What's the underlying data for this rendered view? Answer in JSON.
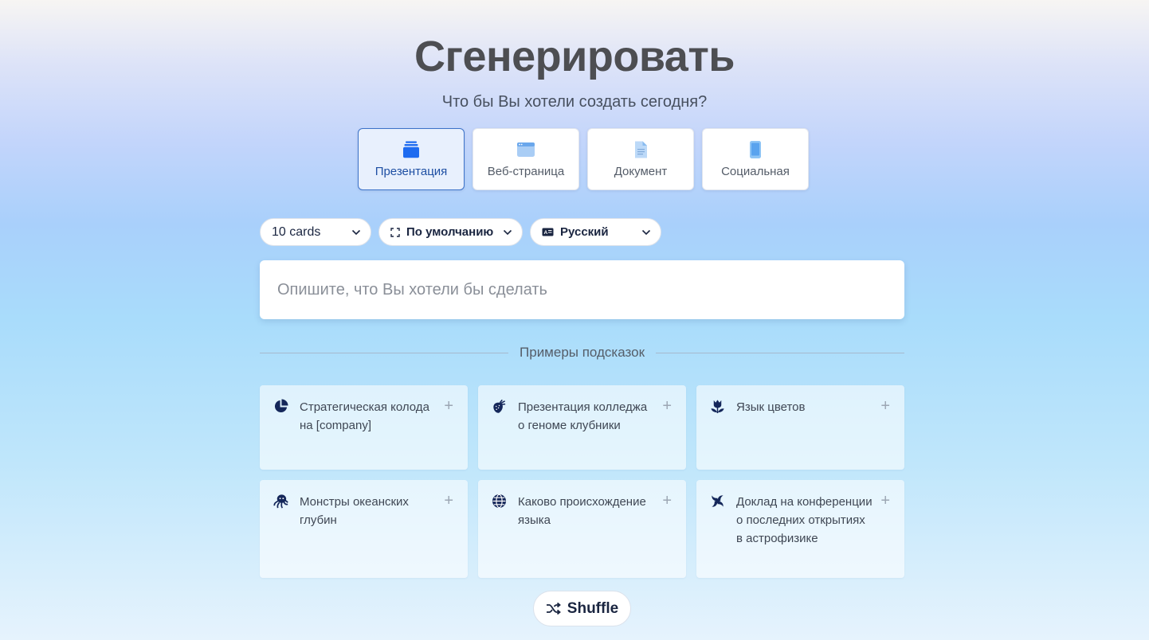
{
  "header": {
    "title": "Сгенерировать",
    "subtitle": "Что бы Вы хотели создать сегодня?"
  },
  "content_types": [
    {
      "label": "Презентация",
      "icon": "presentation-stack-icon",
      "active": true
    },
    {
      "label": "Веб-страница",
      "icon": "webpage-icon",
      "active": false
    },
    {
      "label": "Документ",
      "icon": "document-icon",
      "active": false
    },
    {
      "label": "Социальная",
      "icon": "phone-icon",
      "active": false
    }
  ],
  "selectors": {
    "cards": {
      "value": "10 cards",
      "icon": "chevron-down-icon"
    },
    "theme": {
      "value": "По умолчанию",
      "icon": "aspect-ratio-icon"
    },
    "language": {
      "value": "Русский",
      "icon": "language-icon"
    }
  },
  "prompt": {
    "placeholder": "Опишите, что Вы хотели бы сделать",
    "value": ""
  },
  "examples": {
    "heading": "Примеры подсказок",
    "items": [
      {
        "text": "Стратегическая колода на [company]",
        "icon": "pie-chart-icon"
      },
      {
        "text": "Презентация колледжа о геноме клубники",
        "icon": "strawberry-icon"
      },
      {
        "text": "Язык цветов",
        "icon": "flower-icon"
      },
      {
        "text": "Монстры океанских глубин",
        "icon": "octopus-icon"
      },
      {
        "text": "Каково происхождение языка",
        "icon": "globe-icon"
      },
      {
        "text": "Доклад на конференции о последних открытиях в астрофизике",
        "icon": "galaxy-icon"
      }
    ]
  },
  "shuffle": {
    "label": "Shuffle",
    "icon": "shuffle-icon"
  },
  "colors": {
    "accent": "#1e6bf0",
    "active_tab_border": "#3c72c9",
    "icon_navy": "#14275a"
  }
}
